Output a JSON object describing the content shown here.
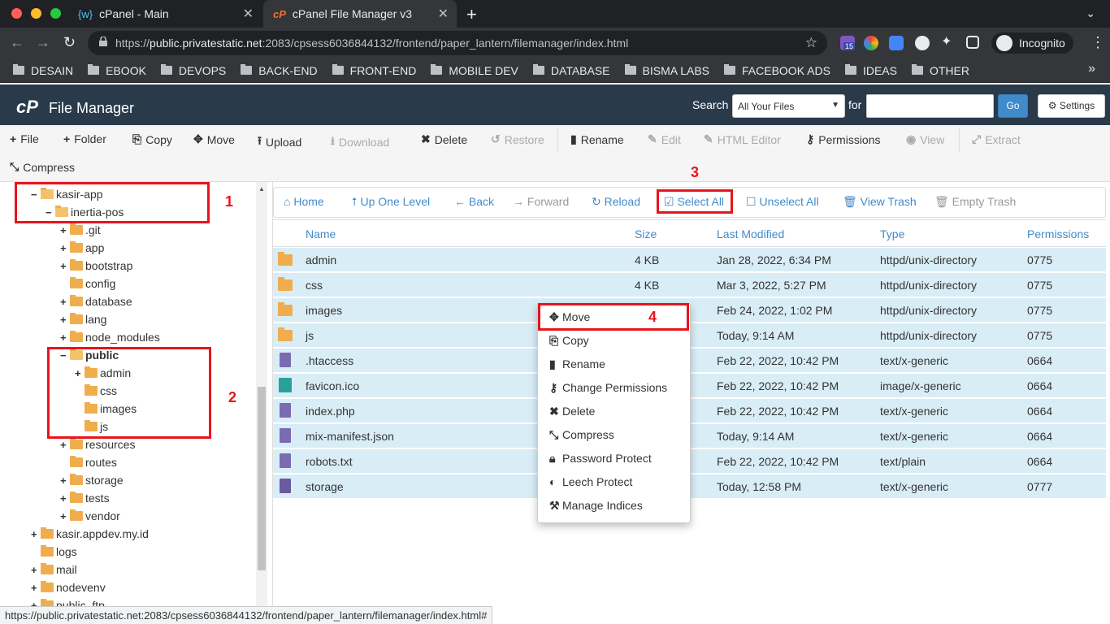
{
  "browser": {
    "tabs": [
      {
        "title": "cPanel - Main",
        "icon": "cpanel-main-icon"
      },
      {
        "title": "cPanel File Manager v3",
        "icon": "cpanel-icon"
      }
    ],
    "url_prefix": "https://",
    "url_host": "public.privatestatic.net",
    "url_rest": ":2083/cpsess6036844132/frontend/paper_lantern/filemanager/index.html",
    "incognito_label": "Incognito",
    "extension_badge": "15",
    "bookmarks": [
      "DESAIN",
      "EBOOK",
      "DEVOPS",
      "BACK-END",
      "FRONT-END",
      "MOBILE DEV",
      "DATABASE",
      "BISMA LABS",
      "FACEBOOK ADS",
      "IDEAS",
      "OTHER"
    ]
  },
  "header": {
    "logo": "cP",
    "title": "File Manager",
    "search_label": "Search",
    "search_scope": "All Your Files",
    "for_label": "for",
    "go_label": "Go",
    "settings_label": "Settings"
  },
  "toolbar": {
    "file": "File",
    "folder": "Folder",
    "copy": "Copy",
    "move": "Move",
    "upload": "Upload",
    "download": "Download",
    "delete": "Delete",
    "restore": "Restore",
    "rename": "Rename",
    "edit": "Edit",
    "html_editor": "HTML Editor",
    "permissions": "Permissions",
    "view": "View",
    "extract": "Extract",
    "compress": "Compress"
  },
  "tree": [
    {
      "label": "kasir-app",
      "toggle": "−",
      "open": true
    },
    {
      "label": "inertia-pos",
      "toggle": "−",
      "open": true
    },
    {
      "label": ".git",
      "toggle": "+"
    },
    {
      "label": "app",
      "toggle": "+"
    },
    {
      "label": "bootstrap",
      "toggle": "+"
    },
    {
      "label": "config",
      "toggle": ""
    },
    {
      "label": "database",
      "toggle": "+"
    },
    {
      "label": "lang",
      "toggle": "+"
    },
    {
      "label": "node_modules",
      "toggle": "+"
    },
    {
      "label": "public",
      "toggle": "−",
      "open": true,
      "bold": true
    },
    {
      "label": "admin",
      "toggle": "+"
    },
    {
      "label": "css",
      "toggle": ""
    },
    {
      "label": "images",
      "toggle": ""
    },
    {
      "label": "js",
      "toggle": ""
    },
    {
      "label": "resources",
      "toggle": "+"
    },
    {
      "label": "routes",
      "toggle": ""
    },
    {
      "label": "storage",
      "toggle": "+"
    },
    {
      "label": "tests",
      "toggle": "+"
    },
    {
      "label": "vendor",
      "toggle": "+"
    },
    {
      "label": "kasir.appdev.my.id",
      "toggle": "+"
    },
    {
      "label": "logs",
      "toggle": ""
    },
    {
      "label": "mail",
      "toggle": "+"
    },
    {
      "label": "nodevenv",
      "toggle": "+"
    },
    {
      "label": "public_ftp",
      "toggle": "+"
    }
  ],
  "nav": {
    "home": "Home",
    "up": "Up One Level",
    "back": "Back",
    "forward": "Forward",
    "reload": "Reload",
    "select_all": "Select All",
    "unselect_all": "Unselect All",
    "view_trash": "View Trash",
    "empty_trash": "Empty Trash"
  },
  "columns": {
    "name": "Name",
    "size": "Size",
    "modified": "Last Modified",
    "type": "Type",
    "perms": "Permissions"
  },
  "files": [
    {
      "name": "admin",
      "size": "4 KB",
      "modified": "Jan 28, 2022, 6:34 PM",
      "type": "httpd/unix-directory",
      "perms": "0775",
      "icon": "folder"
    },
    {
      "name": "css",
      "size": "4 KB",
      "modified": "Mar 3, 2022, 5:27 PM",
      "type": "httpd/unix-directory",
      "perms": "0775",
      "icon": "folder"
    },
    {
      "name": "images",
      "size": "",
      "modified": "Feb 24, 2022, 1:02 PM",
      "type": "httpd/unix-directory",
      "perms": "0775",
      "icon": "folder"
    },
    {
      "name": "js",
      "size": "",
      "modified": "Today, 9:14 AM",
      "type": "httpd/unix-directory",
      "perms": "0775",
      "icon": "folder"
    },
    {
      "name": ".htaccess",
      "size": "",
      "modified": "Feb 22, 2022, 10:42 PM",
      "type": "text/x-generic",
      "perms": "0664",
      "icon": "doc"
    },
    {
      "name": "favicon.ico",
      "size": "",
      "modified": "Feb 22, 2022, 10:42 PM",
      "type": "image/x-generic",
      "perms": "0664",
      "icon": "img"
    },
    {
      "name": "index.php",
      "size": "",
      "modified": "Feb 22, 2022, 10:42 PM",
      "type": "text/x-generic",
      "perms": "0664",
      "icon": "doc"
    },
    {
      "name": "mix-manifest.json",
      "size": "",
      "modified": "Today, 9:14 AM",
      "type": "text/x-generic",
      "perms": "0664",
      "icon": "doc"
    },
    {
      "name": "robots.txt",
      "size": "",
      "modified": "Feb 22, 2022, 10:42 PM",
      "type": "text/plain",
      "perms": "0664",
      "icon": "doc"
    },
    {
      "name": "storage",
      "size": "",
      "modified": "Today, 12:58 PM",
      "type": "text/x-generic",
      "perms": "0777",
      "icon": "link"
    }
  ],
  "context_menu": [
    "Move",
    "Copy",
    "Rename",
    "Change Permissions",
    "Delete",
    "Compress",
    "Password Protect",
    "Leech Protect",
    "Manage Indices"
  ],
  "annotations": [
    "1",
    "2",
    "3",
    "4"
  ],
  "status_url": "https://public.privatestatic.net:2083/cpsess6036844132/frontend/paper_lantern/filemanager/index.html#",
  "colors": {
    "accent": "#428bca",
    "annotation": "#e8141b",
    "header_bg": "#293a4a",
    "selected_row": "#d9edf7"
  }
}
